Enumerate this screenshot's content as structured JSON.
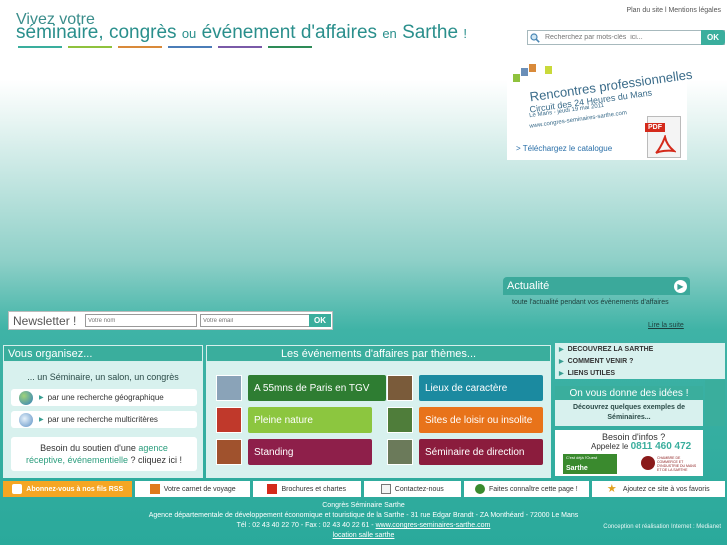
{
  "header": {
    "line1": "Vivez votre",
    "seminaire": "séminaire,",
    "congres": "congrès",
    "ou": "ou",
    "evenement": "événement d'affaires",
    "en": "en",
    "sarthe": "Sarthe",
    "bang": "!",
    "underbar_colors": [
      "#3aae9d",
      "#8fc23d",
      "#d98a3a",
      "#4b7db8",
      "#7a5aa8",
      "#2e8b57"
    ]
  },
  "toplinks": "Plan du site l Mentions légales",
  "search": {
    "placeholder": "Recherchez par mots-clés  ici...",
    "button": "OK"
  },
  "promo": {
    "title": "Rencontres professionnelles",
    "subtitle": "Circuit des 24 Heures du Mans",
    "date": "Le Mans - jeudi 19 mai 2011",
    "url": "www.congres-seminaires-sarthe.com",
    "catalogue": "> Téléchargez le catalogue",
    "pdf_label": "PDF"
  },
  "actualite": {
    "title": "Actualité",
    "text": "toute l'actualité pendant vos évènements d'affaires",
    "more": "Lire la suite"
  },
  "newsletter": {
    "label": "Newsletter !",
    "name_placeholder": "Votre nom",
    "email_placeholder": "Votre email",
    "button": "OK"
  },
  "organisez": {
    "title": "Vous organisez...",
    "head": "... un Séminaire, un salon, un congrès",
    "geo": "par une recherche géographique",
    "multi": "par une recherche multicritères",
    "soutien_1": "Besoin du soutien d'une ",
    "soutien_hl1": "agence",
    "soutien_hl2": "réceptive, événementielle",
    "soutien_2": " ? cliquez ici !"
  },
  "themes": {
    "title": "Les événements d'affaires par thèmes...",
    "items": [
      {
        "label": "A 55mns de Paris en TGV",
        "color": "#2e7d32",
        "thumb": "#8aa3b8"
      },
      {
        "label": "Lieux de caractère",
        "color": "#1b8aa0",
        "thumb": "#7a5b3a"
      },
      {
        "label": "Pleine nature",
        "color": "#8cc63f",
        "thumb": "#c0392b"
      },
      {
        "label": "Sites de loisir ou insolite",
        "color": "#e8731a",
        "thumb": "#4f7d3a"
      },
      {
        "label": "Standing",
        "color": "#8e1f4a",
        "thumb": "#a0522d"
      },
      {
        "label": "Séminaire de direction",
        "color": "#8b1c3d",
        "thumb": "#6b7a5a"
      }
    ]
  },
  "rnav": [
    "DECOUVREZ LA SARTHE",
    "COMMENT VENIR ?",
    "LIENS UTILES"
  ],
  "idees": {
    "title": "On vous donne des idées !",
    "text": "Découvrez quelques exemples de Séminaires..."
  },
  "infos": {
    "question": "Besoin d'infos ?",
    "appel": "Appelez le",
    "numero": "0811 460 472",
    "logo1_sub": "C'est déjà l'Ouest",
    "logo1": "Sarthe",
    "logo2": "CHAMBRE DE COMMERCE ET D'INDUSTRIE DU MANS ET DE LA SARTHE"
  },
  "bottombar": {
    "rss": "Abonnez-vous à nos fils RSS",
    "carnet": "Votre carnet de voyage",
    "brochures": "Brochures et chartes",
    "contact": "Contactez-nous",
    "connaitre": "Faites connaître cette page !",
    "favoris": "Ajoutez ce site à vos favoris"
  },
  "footer": {
    "line1": "Congrès Séminaire Sarthe",
    "line2": "Agence départementale de développement économique et touristique de la Sarthe - 31 rue Edgar Brandt - ZA Monthéard - 72000 Le Mans",
    "line3": "Tél : 02 43 40 22 70 - Fax : 02 43 40 22 61 - ",
    "site": "www.congres-seminaires-sarthe.com",
    "location": "location salle sarthe",
    "credit": "Conception et réalisation Internet : Medianet"
  }
}
